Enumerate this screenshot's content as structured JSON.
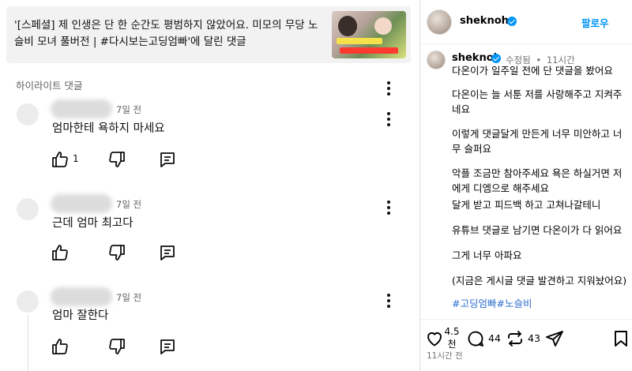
{
  "video": {
    "title": "'[스페셜] 제 인생은 단 한 순간도 평범하지 않았어요. 미모의 무당 노슬비 모녀 풀버전 | #다시보는고딩엄빠'에 달린 댓글"
  },
  "comments_section": {
    "label": "하이라이트 댓글",
    "items": [
      {
        "time": "7일 전",
        "text": "엄마한테 욕하지 마세요",
        "likes": "1"
      },
      {
        "time": "7일 전",
        "text": "근데 엄마 최고다",
        "likes": ""
      },
      {
        "time": "7일 전",
        "text": "엄마 잘한다",
        "likes": ""
      }
    ]
  },
  "instagram": {
    "header": {
      "username": "sheknoh",
      "follow_label": "팔로우"
    },
    "post": {
      "username": "sheknoh",
      "edited": "수정됨",
      "dot": "•",
      "time": "11시간",
      "caption": [
        "다온이가 일주일 전에 단 댓글을 봤어요",
        "다온이는 늘 서툰 저를 사랑해주고 지켜주네요",
        "이렇게 댓글달게 만든게 너무 미안하고 너무 슬퍼요",
        "악플 조금만 참아주세요 욕은 하실거면 저에게 디엠으로 해주세요",
        "달게 받고 피드백 하고 고쳐나갈테니",
        "유튜브 댓글로 남기면 다온이가 다 읽어요",
        "그게 너무 아파요",
        "(지금은 게시글 댓글 발견하고 지워놨어요)"
      ],
      "hashtags": [
        "#고딩엄빠",
        "#노슬비"
      ]
    },
    "actions": {
      "likes_line1": "4.5",
      "likes_line2": "천",
      "comments": "44",
      "reposts": "43",
      "time_ago": "11시간 전"
    }
  },
  "colors": {
    "ig_blue": "#0095f6",
    "verified_blue": "#0095f6",
    "hashtag_blue": "#2f6fcf",
    "banner_bg": "#f2f2f2"
  },
  "icons": [
    "thumbs-up-icon",
    "thumbs-down-icon",
    "reply-icon",
    "more-vert-icon",
    "verified-icon",
    "heart-icon",
    "comment-icon",
    "repost-icon",
    "share-icon",
    "bookmark-icon"
  ]
}
